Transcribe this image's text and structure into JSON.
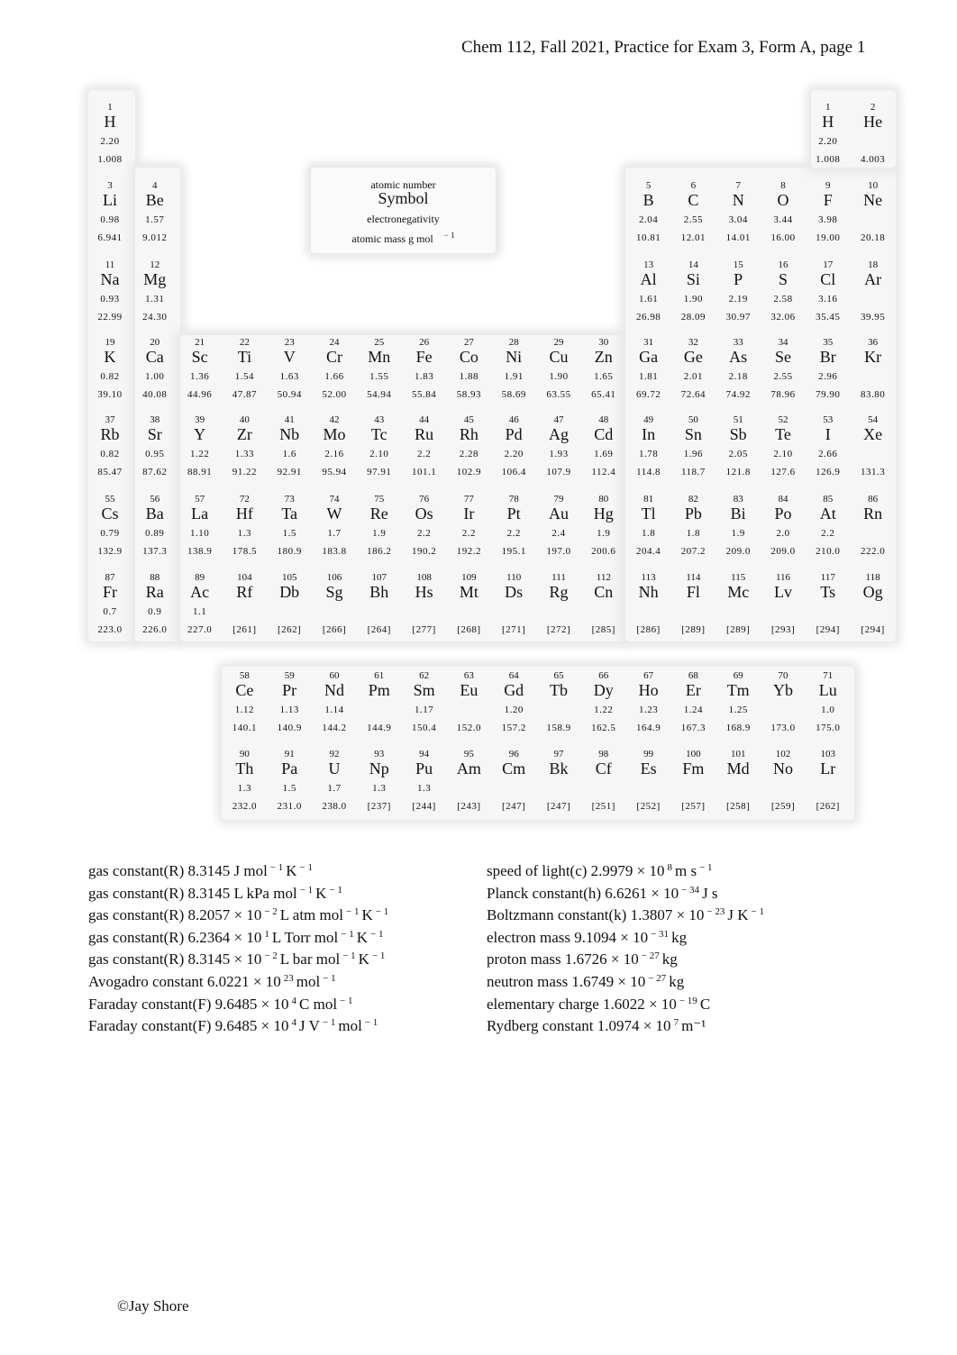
{
  "header": {
    "title": "Chem 112, Fall 2021, Practice for Exam 3, Form A, page 1"
  },
  "legend": {
    "atomic_number": "atomic number",
    "symbol": "Symbol",
    "electronegativity": "electronegativity",
    "atomic_mass": "atomic mass g mol",
    "atomic_mass_exp": "− 1"
  },
  "elements": [
    {
      "n": "1",
      "s": "H",
      "en": "2.20",
      "m": "1.008",
      "r": 1,
      "c": 1
    },
    {
      "n": "1",
      "s": "H",
      "en": "2.20",
      "m": "1.008",
      "r": 1,
      "c": 17
    },
    {
      "n": "2",
      "s": "He",
      "en": "",
      "m": "4.003",
      "r": 1,
      "c": 18
    },
    {
      "n": "3",
      "s": "Li",
      "en": "0.98",
      "m": "6.941",
      "r": 2,
      "c": 1
    },
    {
      "n": "4",
      "s": "Be",
      "en": "1.57",
      "m": "9.012",
      "r": 2,
      "c": 2
    },
    {
      "n": "5",
      "s": "B",
      "en": "2.04",
      "m": "10.81",
      "r": 2,
      "c": 13
    },
    {
      "n": "6",
      "s": "C",
      "en": "2.55",
      "m": "12.01",
      "r": 2,
      "c": 14
    },
    {
      "n": "7",
      "s": "N",
      "en": "3.04",
      "m": "14.01",
      "r": 2,
      "c": 15
    },
    {
      "n": "8",
      "s": "O",
      "en": "3.44",
      "m": "16.00",
      "r": 2,
      "c": 16
    },
    {
      "n": "9",
      "s": "F",
      "en": "3.98",
      "m": "19.00",
      "r": 2,
      "c": 17
    },
    {
      "n": "10",
      "s": "Ne",
      "en": "",
      "m": "20.18",
      "r": 2,
      "c": 18
    },
    {
      "n": "11",
      "s": "Na",
      "en": "0.93",
      "m": "22.99",
      "r": 3,
      "c": 1
    },
    {
      "n": "12",
      "s": "Mg",
      "en": "1.31",
      "m": "24.30",
      "r": 3,
      "c": 2
    },
    {
      "n": "13",
      "s": "Al",
      "en": "1.61",
      "m": "26.98",
      "r": 3,
      "c": 13
    },
    {
      "n": "14",
      "s": "Si",
      "en": "1.90",
      "m": "28.09",
      "r": 3,
      "c": 14
    },
    {
      "n": "15",
      "s": "P",
      "en": "2.19",
      "m": "30.97",
      "r": 3,
      "c": 15
    },
    {
      "n": "16",
      "s": "S",
      "en": "2.58",
      "m": "32.06",
      "r": 3,
      "c": 16
    },
    {
      "n": "17",
      "s": "Cl",
      "en": "3.16",
      "m": "35.45",
      "r": 3,
      "c": 17
    },
    {
      "n": "18",
      "s": "Ar",
      "en": "",
      "m": "39.95",
      "r": 3,
      "c": 18
    },
    {
      "n": "19",
      "s": "K",
      "en": "0.82",
      "m": "39.10",
      "r": 4,
      "c": 1
    },
    {
      "n": "20",
      "s": "Ca",
      "en": "1.00",
      "m": "40.08",
      "r": 4,
      "c": 2
    },
    {
      "n": "21",
      "s": "Sc",
      "en": "1.36",
      "m": "44.96",
      "r": 4,
      "c": 3
    },
    {
      "n": "22",
      "s": "Ti",
      "en": "1.54",
      "m": "47.87",
      "r": 4,
      "c": 4
    },
    {
      "n": "23",
      "s": "V",
      "en": "1.63",
      "m": "50.94",
      "r": 4,
      "c": 5
    },
    {
      "n": "24",
      "s": "Cr",
      "en": "1.66",
      "m": "52.00",
      "r": 4,
      "c": 6
    },
    {
      "n": "25",
      "s": "Mn",
      "en": "1.55",
      "m": "54.94",
      "r": 4,
      "c": 7
    },
    {
      "n": "26",
      "s": "Fe",
      "en": "1.83",
      "m": "55.84",
      "r": 4,
      "c": 8
    },
    {
      "n": "27",
      "s": "Co",
      "en": "1.88",
      "m": "58.93",
      "r": 4,
      "c": 9
    },
    {
      "n": "28",
      "s": "Ni",
      "en": "1.91",
      "m": "58.69",
      "r": 4,
      "c": 10
    },
    {
      "n": "29",
      "s": "Cu",
      "en": "1.90",
      "m": "63.55",
      "r": 4,
      "c": 11
    },
    {
      "n": "30",
      "s": "Zn",
      "en": "1.65",
      "m": "65.41",
      "r": 4,
      "c": 12
    },
    {
      "n": "31",
      "s": "Ga",
      "en": "1.81",
      "m": "69.72",
      "r": 4,
      "c": 13
    },
    {
      "n": "32",
      "s": "Ge",
      "en": "2.01",
      "m": "72.64",
      "r": 4,
      "c": 14
    },
    {
      "n": "33",
      "s": "As",
      "en": "2.18",
      "m": "74.92",
      "r": 4,
      "c": 15
    },
    {
      "n": "34",
      "s": "Se",
      "en": "2.55",
      "m": "78.96",
      "r": 4,
      "c": 16
    },
    {
      "n": "35",
      "s": "Br",
      "en": "2.96",
      "m": "79.90",
      "r": 4,
      "c": 17
    },
    {
      "n": "36",
      "s": "Kr",
      "en": "",
      "m": "83.80",
      "r": 4,
      "c": 18
    },
    {
      "n": "37",
      "s": "Rb",
      "en": "0.82",
      "m": "85.47",
      "r": 5,
      "c": 1
    },
    {
      "n": "38",
      "s": "Sr",
      "en": "0.95",
      "m": "87.62",
      "r": 5,
      "c": 2
    },
    {
      "n": "39",
      "s": "Y",
      "en": "1.22",
      "m": "88.91",
      "r": 5,
      "c": 3
    },
    {
      "n": "40",
      "s": "Zr",
      "en": "1.33",
      "m": "91.22",
      "r": 5,
      "c": 4
    },
    {
      "n": "41",
      "s": "Nb",
      "en": "1.6",
      "m": "92.91",
      "r": 5,
      "c": 5
    },
    {
      "n": "42",
      "s": "Mo",
      "en": "2.16",
      "m": "95.94",
      "r": 5,
      "c": 6
    },
    {
      "n": "43",
      "s": "Tc",
      "en": "2.10",
      "m": "97.91",
      "r": 5,
      "c": 7
    },
    {
      "n": "44",
      "s": "Ru",
      "en": "2.2",
      "m": "101.1",
      "r": 5,
      "c": 8
    },
    {
      "n": "45",
      "s": "Rh",
      "en": "2.28",
      "m": "102.9",
      "r": 5,
      "c": 9
    },
    {
      "n": "46",
      "s": "Pd",
      "en": "2.20",
      "m": "106.4",
      "r": 5,
      "c": 10
    },
    {
      "n": "47",
      "s": "Ag",
      "en": "1.93",
      "m": "107.9",
      "r": 5,
      "c": 11
    },
    {
      "n": "48",
      "s": "Cd",
      "en": "1.69",
      "m": "112.4",
      "r": 5,
      "c": 12
    },
    {
      "n": "49",
      "s": "In",
      "en": "1.78",
      "m": "114.8",
      "r": 5,
      "c": 13
    },
    {
      "n": "50",
      "s": "Sn",
      "en": "1.96",
      "m": "118.7",
      "r": 5,
      "c": 14
    },
    {
      "n": "51",
      "s": "Sb",
      "en": "2.05",
      "m": "121.8",
      "r": 5,
      "c": 15
    },
    {
      "n": "52",
      "s": "Te",
      "en": "2.10",
      "m": "127.6",
      "r": 5,
      "c": 16
    },
    {
      "n": "53",
      "s": "I",
      "en": "2.66",
      "m": "126.9",
      "r": 5,
      "c": 17
    },
    {
      "n": "54",
      "s": "Xe",
      "en": "",
      "m": "131.3",
      "r": 5,
      "c": 18
    },
    {
      "n": "55",
      "s": "Cs",
      "en": "0.79",
      "m": "132.9",
      "r": 6,
      "c": 1
    },
    {
      "n": "56",
      "s": "Ba",
      "en": "0.89",
      "m": "137.3",
      "r": 6,
      "c": 2
    },
    {
      "n": "57",
      "s": "La",
      "en": "1.10",
      "m": "138.9",
      "r": 6,
      "c": 3
    },
    {
      "n": "72",
      "s": "Hf",
      "en": "1.3",
      "m": "178.5",
      "r": 6,
      "c": 4
    },
    {
      "n": "73",
      "s": "Ta",
      "en": "1.5",
      "m": "180.9",
      "r": 6,
      "c": 5
    },
    {
      "n": "74",
      "s": "W",
      "en": "1.7",
      "m": "183.8",
      "r": 6,
      "c": 6
    },
    {
      "n": "75",
      "s": "Re",
      "en": "1.9",
      "m": "186.2",
      "r": 6,
      "c": 7
    },
    {
      "n": "76",
      "s": "Os",
      "en": "2.2",
      "m": "190.2",
      "r": 6,
      "c": 8
    },
    {
      "n": "77",
      "s": "Ir",
      "en": "2.2",
      "m": "192.2",
      "r": 6,
      "c": 9
    },
    {
      "n": "78",
      "s": "Pt",
      "en": "2.2",
      "m": "195.1",
      "r": 6,
      "c": 10
    },
    {
      "n": "79",
      "s": "Au",
      "en": "2.4",
      "m": "197.0",
      "r": 6,
      "c": 11
    },
    {
      "n": "80",
      "s": "Hg",
      "en": "1.9",
      "m": "200.6",
      "r": 6,
      "c": 12
    },
    {
      "n": "81",
      "s": "Tl",
      "en": "1.8",
      "m": "204.4",
      "r": 6,
      "c": 13
    },
    {
      "n": "82",
      "s": "Pb",
      "en": "1.8",
      "m": "207.2",
      "r": 6,
      "c": 14
    },
    {
      "n": "83",
      "s": "Bi",
      "en": "1.9",
      "m": "209.0",
      "r": 6,
      "c": 15
    },
    {
      "n": "84",
      "s": "Po",
      "en": "2.0",
      "m": "209.0",
      "r": 6,
      "c": 16
    },
    {
      "n": "85",
      "s": "At",
      "en": "2.2",
      "m": "210.0",
      "r": 6,
      "c": 17
    },
    {
      "n": "86",
      "s": "Rn",
      "en": "",
      "m": "222.0",
      "r": 6,
      "c": 18
    },
    {
      "n": "87",
      "s": "Fr",
      "en": "0.7",
      "m": "223.0",
      "r": 7,
      "c": 1
    },
    {
      "n": "88",
      "s": "Ra",
      "en": "0.9",
      "m": "226.0",
      "r": 7,
      "c": 2
    },
    {
      "n": "89",
      "s": "Ac",
      "en": "1.1",
      "m": "227.0",
      "r": 7,
      "c": 3
    },
    {
      "n": "104",
      "s": "Rf",
      "en": "",
      "m": "[261]",
      "r": 7,
      "c": 4
    },
    {
      "n": "105",
      "s": "Db",
      "en": "",
      "m": "[262]",
      "r": 7,
      "c": 5
    },
    {
      "n": "106",
      "s": "Sg",
      "en": "",
      "m": "[266]",
      "r": 7,
      "c": 6
    },
    {
      "n": "107",
      "s": "Bh",
      "en": "",
      "m": "[264]",
      "r": 7,
      "c": 7
    },
    {
      "n": "108",
      "s": "Hs",
      "en": "",
      "m": "[277]",
      "r": 7,
      "c": 8
    },
    {
      "n": "109",
      "s": "Mt",
      "en": "",
      "m": "[268]",
      "r": 7,
      "c": 9
    },
    {
      "n": "110",
      "s": "Ds",
      "en": "",
      "m": "[271]",
      "r": 7,
      "c": 10
    },
    {
      "n": "111",
      "s": "Rg",
      "en": "",
      "m": "[272]",
      "r": 7,
      "c": 11
    },
    {
      "n": "112",
      "s": "Cn",
      "en": "",
      "m": "[285]",
      "r": 7,
      "c": 12
    },
    {
      "n": "113",
      "s": "Nh",
      "en": "",
      "m": "[286]",
      "r": 7,
      "c": 13
    },
    {
      "n": "114",
      "s": "Fl",
      "en": "",
      "m": "[289]",
      "r": 7,
      "c": 14
    },
    {
      "n": "115",
      "s": "Mc",
      "en": "",
      "m": "[289]",
      "r": 7,
      "c": 15
    },
    {
      "n": "116",
      "s": "Lv",
      "en": "",
      "m": "[293]",
      "r": 7,
      "c": 16
    },
    {
      "n": "117",
      "s": "Ts",
      "en": "",
      "m": "[294]",
      "r": 7,
      "c": 17
    },
    {
      "n": "118",
      "s": "Og",
      "en": "",
      "m": "[294]",
      "r": 7,
      "c": 18
    },
    {
      "n": "58",
      "s": "Ce",
      "en": "1.12",
      "m": "140.1",
      "r": 8,
      "c": 4
    },
    {
      "n": "59",
      "s": "Pr",
      "en": "1.13",
      "m": "140.9",
      "r": 8,
      "c": 5
    },
    {
      "n": "60",
      "s": "Nd",
      "en": "1.14",
      "m": "144.2",
      "r": 8,
      "c": 6
    },
    {
      "n": "61",
      "s": "Pm",
      "en": "",
      "m": "144.9",
      "r": 8,
      "c": 7
    },
    {
      "n": "62",
      "s": "Sm",
      "en": "1.17",
      "m": "150.4",
      "r": 8,
      "c": 8
    },
    {
      "n": "63",
      "s": "Eu",
      "en": "",
      "m": "152.0",
      "r": 8,
      "c": 9
    },
    {
      "n": "64",
      "s": "Gd",
      "en": "1.20",
      "m": "157.2",
      "r": 8,
      "c": 10
    },
    {
      "n": "65",
      "s": "Tb",
      "en": "",
      "m": "158.9",
      "r": 8,
      "c": 11
    },
    {
      "n": "66",
      "s": "Dy",
      "en": "1.22",
      "m": "162.5",
      "r": 8,
      "c": 12
    },
    {
      "n": "67",
      "s": "Ho",
      "en": "1.23",
      "m": "164.9",
      "r": 8,
      "c": 13
    },
    {
      "n": "68",
      "s": "Er",
      "en": "1.24",
      "m": "167.3",
      "r": 8,
      "c": 14
    },
    {
      "n": "69",
      "s": "Tm",
      "en": "1.25",
      "m": "168.9",
      "r": 8,
      "c": 15
    },
    {
      "n": "70",
      "s": "Yb",
      "en": "",
      "m": "173.0",
      "r": 8,
      "c": 16
    },
    {
      "n": "71",
      "s": "Lu",
      "en": "1.0",
      "m": "175.0",
      "r": 8,
      "c": 17
    },
    {
      "n": "90",
      "s": "Th",
      "en": "1.3",
      "m": "232.0",
      "r": 9,
      "c": 4
    },
    {
      "n": "91",
      "s": "Pa",
      "en": "1.5",
      "m": "231.0",
      "r": 9,
      "c": 5
    },
    {
      "n": "92",
      "s": "U",
      "en": "1.7",
      "m": "238.0",
      "r": 9,
      "c": 6
    },
    {
      "n": "93",
      "s": "Np",
      "en": "1.3",
      "m": "[237]",
      "r": 9,
      "c": 7
    },
    {
      "n": "94",
      "s": "Pu",
      "en": "1.3",
      "m": "[244]",
      "r": 9,
      "c": 8
    },
    {
      "n": "95",
      "s": "Am",
      "en": "",
      "m": "[243]",
      "r": 9,
      "c": 9
    },
    {
      "n": "96",
      "s": "Cm",
      "en": "",
      "m": "[247]",
      "r": 9,
      "c": 10
    },
    {
      "n": "97",
      "s": "Bk",
      "en": "",
      "m": "[247]",
      "r": 9,
      "c": 11
    },
    {
      "n": "98",
      "s": "Cf",
      "en": "",
      "m": "[251]",
      "r": 9,
      "c": 12
    },
    {
      "n": "99",
      "s": "Es",
      "en": "",
      "m": "[252]",
      "r": 9,
      "c": 13
    },
    {
      "n": "100",
      "s": "Fm",
      "en": "",
      "m": "[257]",
      "r": 9,
      "c": 14
    },
    {
      "n": "101",
      "s": "Md",
      "en": "",
      "m": "[258]",
      "r": 9,
      "c": 15
    },
    {
      "n": "102",
      "s": "No",
      "en": "",
      "m": "[259]",
      "r": 9,
      "c": 16
    },
    {
      "n": "103",
      "s": "Lr",
      "en": "",
      "m": "[262]",
      "r": 9,
      "c": 17
    }
  ],
  "constants_left": [
    {
      "pre": "gas constant(R) 8.3145 J mol",
      "exp": "− 1",
      "post": "K",
      "exp2": "− 1"
    },
    {
      "pre": "gas constant(R) 8.3145 L kPa mol",
      "exp": "− 1",
      "post": "K",
      "exp2": "− 1"
    },
    {
      "pre": "gas constant(R) 8.2057 × 10",
      "exp": "− 2",
      "post": "L atm mol",
      "exp2": "− 1",
      "post2": "K",
      "exp3": "− 1"
    },
    {
      "pre": "gas constant(R) 6.2364 × 10",
      "exp": "1",
      "post": "L Torr mol",
      "exp2": "− 1",
      "post2": "K",
      "exp3": "− 1"
    },
    {
      "pre": "gas constant(R) 8.3145 × 10",
      "exp": "− 2",
      "post": "L bar mol",
      "exp2": "− 1",
      "post2": "K",
      "exp3": "− 1"
    },
    {
      "pre": "Avogadro constant 6.0221 × 10",
      "exp": "23",
      "post": "mol",
      "exp2": "− 1"
    },
    {
      "pre": "Faraday constant(F) 9.6485 × 10",
      "exp": "4",
      "post": "C mol",
      "exp2": "− 1"
    },
    {
      "pre": "Faraday constant(F) 9.6485 × 10",
      "exp": "4",
      "post": "J V",
      "exp2": "− 1",
      "post2": "mol",
      "exp3": "− 1"
    }
  ],
  "constants_right": [
    {
      "pre": "speed of light(c) 2.9979 × 10",
      "exp": "8",
      "post": "m s",
      "exp2": "− 1"
    },
    {
      "pre": "Planck constant(h) 6.6261 × 10",
      "exp": "− 34",
      "post": "J s"
    },
    {
      "pre": "Boltzmann constant(k) 1.3807 × 10",
      "exp": "− 23",
      "post": "J K",
      "exp2": "− 1"
    },
    {
      "pre": "electron mass 9.1094 × 10",
      "exp": "− 31",
      "post": "kg"
    },
    {
      "pre": "proton mass 1.6726 × 10",
      "exp": "− 27",
      "post": "kg"
    },
    {
      "pre": "neutron mass 1.6749 × 10",
      "exp": "− 27",
      "post": "kg"
    },
    {
      "pre": "elementary charge 1.6022 × 10",
      "exp": "− 19",
      "post": "C"
    },
    {
      "pre": "Rydberg constant 1.0974 × 10",
      "exp": "7",
      "post": "m⁻¹"
    }
  ],
  "footer": {
    "copyright": "©Jay Shore"
  }
}
